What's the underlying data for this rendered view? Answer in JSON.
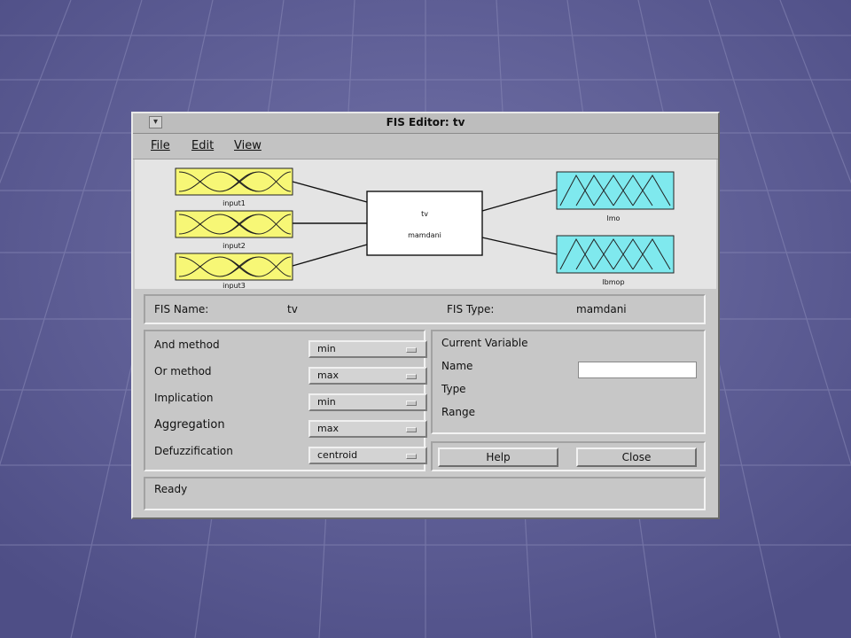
{
  "window": {
    "title": "FIS Editor: tv",
    "system_button_glyph": "▾"
  },
  "menu": [
    {
      "label": "File"
    },
    {
      "label": "Edit"
    },
    {
      "label": "View"
    }
  ],
  "diagram": {
    "inputs": [
      {
        "label": "input1"
      },
      {
        "label": "input2"
      },
      {
        "label": "input3"
      }
    ],
    "system": {
      "name": "tv",
      "type": "mamdani"
    },
    "outputs": [
      {
        "label": "lmo"
      },
      {
        "label": "lbmop"
      }
    ],
    "colors": {
      "input": "#f7f776",
      "output": "#7fe9ee"
    }
  },
  "info": {
    "fis_name_label": "FIS Name:",
    "fis_name_value": "tv",
    "fis_type_label": "FIS Type:",
    "fis_type_value": "mamdani"
  },
  "methods": [
    {
      "label": "And method",
      "value": "min"
    },
    {
      "label": "Or method",
      "value": "max"
    },
    {
      "label": "Implication",
      "value": "min"
    },
    {
      "label": "Aggregation",
      "value": "max"
    },
    {
      "label": "Defuzzification",
      "value": "centroid"
    }
  ],
  "current_variable": {
    "title": "Current Variable",
    "name_label": "Name",
    "type_label": "Type",
    "range_label": "Range",
    "name_value": ""
  },
  "buttons": {
    "help": "Help",
    "close": "Close"
  },
  "status": "Ready"
}
